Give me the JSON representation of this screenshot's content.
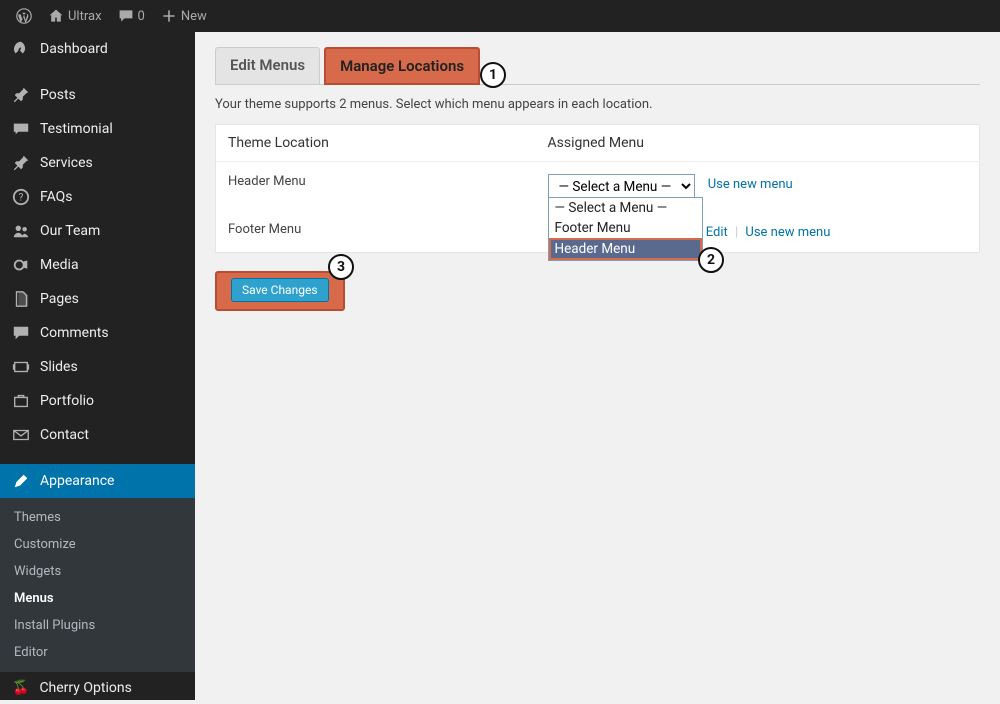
{
  "adminbar": {
    "site_name": "Ultrax",
    "comments_count": "0",
    "new_label": "New"
  },
  "sidebar": {
    "items": [
      {
        "label": "Dashboard",
        "icon": "dashboard"
      },
      {
        "label": "Posts",
        "icon": "pin"
      },
      {
        "label": "Testimonial",
        "icon": "quote"
      },
      {
        "label": "Services",
        "icon": "pin"
      },
      {
        "label": "FAQs",
        "icon": "help"
      },
      {
        "label": "Our Team",
        "icon": "team"
      },
      {
        "label": "Media",
        "icon": "media"
      },
      {
        "label": "Pages",
        "icon": "pages"
      },
      {
        "label": "Comments",
        "icon": "comment"
      },
      {
        "label": "Slides",
        "icon": "slides"
      },
      {
        "label": "Portfolio",
        "icon": "portfolio"
      },
      {
        "label": "Contact",
        "icon": "contact"
      },
      {
        "label": "Appearance",
        "icon": "appearance",
        "active": true
      },
      {
        "label": "Cherry Options",
        "icon": "cherry"
      }
    ],
    "appearance_submenu": [
      {
        "label": "Themes"
      },
      {
        "label": "Customize"
      },
      {
        "label": "Widgets"
      },
      {
        "label": "Menus",
        "current": true
      },
      {
        "label": "Install Plugins"
      },
      {
        "label": "Editor"
      }
    ]
  },
  "tabs": {
    "edit": "Edit Menus",
    "manage": "Manage Locations"
  },
  "helptext": "Your theme supports 2 menus. Select which menu appears in each location.",
  "table": {
    "col_location": "Theme Location",
    "col_assigned": "Assigned Menu",
    "rows": [
      {
        "location": "Header Menu",
        "selected": "— Select a Menu —",
        "options": [
          "— Select a Menu —",
          "Footer Menu",
          "Header Menu"
        ],
        "links": {
          "use_new": "Use new menu"
        }
      },
      {
        "location": "Footer Menu",
        "links": {
          "edit": "Edit",
          "use_new": "Use new menu"
        }
      }
    ]
  },
  "save_button": "Save Changes",
  "callouts": {
    "one": "1",
    "two": "2",
    "three": "3"
  }
}
